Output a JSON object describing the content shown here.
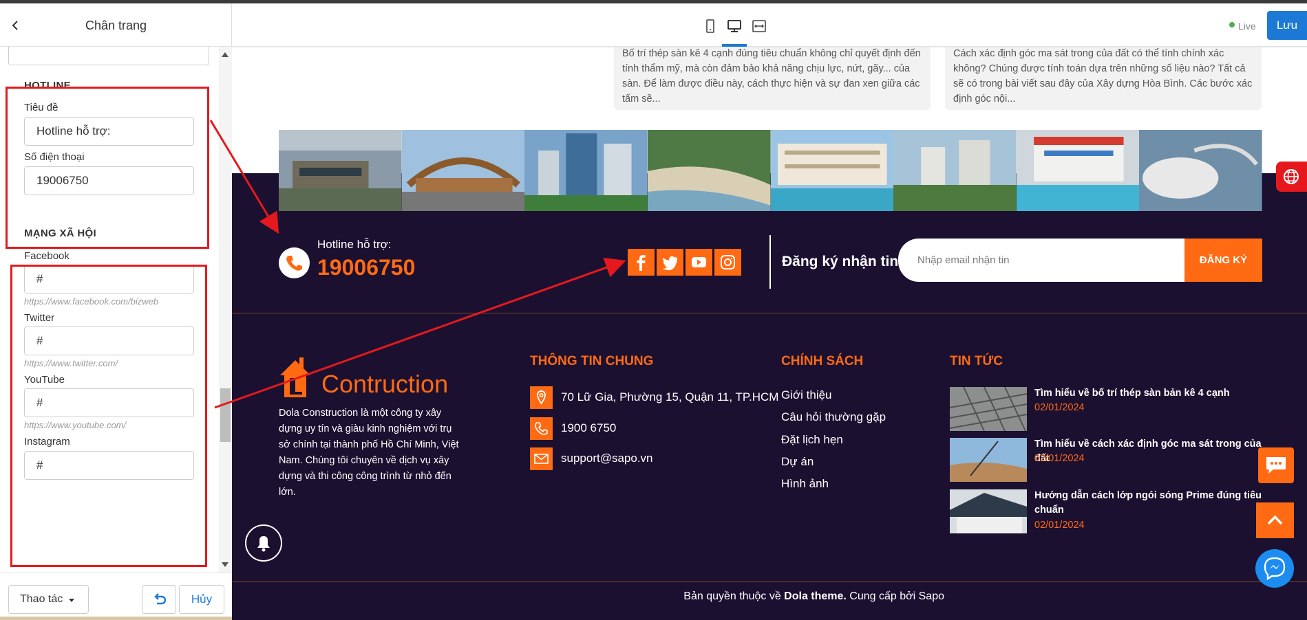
{
  "panel": {
    "title": "Chân trang",
    "hotline_section": {
      "title": "HOTLINE",
      "title_label": "Tiêu đề",
      "title_value": "Hotline hỗ trợ:",
      "phone_label": "Số điện thoại",
      "phone_value": "19006750"
    },
    "social_section": {
      "title": "MẠNG XÃ HỘI",
      "facebook_label": "Facebook",
      "facebook_value": "#",
      "facebook_hint": "https://www.facebook.com/bizweb",
      "twitter_label": "Twitter",
      "twitter_value": "#",
      "twitter_hint": "https://www.twitter.com/",
      "youtube_label": "YouTube",
      "youtube_value": "#",
      "youtube_hint": "https://www.youtube.com/",
      "instagram_label": "Instagram",
      "instagram_value": "#"
    },
    "footer": {
      "actions_label": "Thao tác",
      "cancel_label": "Hủy"
    }
  },
  "topbar": {
    "live_label": "Live",
    "save_label": "Lưu",
    "devices": [
      "mobile-icon",
      "desktop-icon",
      "fullwidth-icon"
    ],
    "active_device": "desktop"
  },
  "preview": {
    "news_cards": [
      "Bố trí thép sàn kê 4 cạnh đúng tiêu chuẩn không chỉ quyết định đến tính thẩm mỹ, mà còn đảm bảo khả năng chịu lực, nứt, gãy... của sàn. Để làm được điều này, cách thực hiện và sự đan xen giữa các tấm sẽ...",
      "Cách xác định góc ma sát trong của đất có thể tính chính xác không? Chúng được tính toán dựa trên những số liệu nào? Tất cả sẽ có trong bài viết sau đây của Xây dựng Hòa Bình. Các bước xác định góc nội..."
    ],
    "hotline_label": "Hotline hỗ trợ:",
    "hotline_number": "19006750",
    "socials": [
      "facebook-icon",
      "twitter-icon",
      "youtube-icon",
      "instagram-icon"
    ],
    "subscribe_title": "Đăng ký nhận tin",
    "email_placeholder": "Nhập email nhận tin",
    "subscribe_button": "ĐĂNG KÝ",
    "logo_text": "Contruction",
    "about": "Dola Construction là một công ty xây dựng uy tín và giàu kinh nghiệm với trụ sở chính tại thành phố Hồ Chí Minh, Việt Nam. Chúng tôi chuyên về dịch vụ xây dựng và thi công công trình từ nhỏ đến lớn.",
    "info_title": "THÔNG TIN CHUNG",
    "address": "70 Lữ Gia, Phường 15, Quận 11, TP.HCM",
    "phone": "1900 6750",
    "email": "support@sapo.vn",
    "policy_title": "CHÍNH SÁCH",
    "policy_links": [
      "Giới thiệu",
      "Câu hỏi thường gặp",
      "Đặt lịch hẹn",
      "Dự án",
      "Hình ảnh"
    ],
    "news_title": "TIN TỨC",
    "news": [
      {
        "title": "Tìm hiểu về bố trí thép sàn bản kê 4 cạnh",
        "date": "02/01/2024"
      },
      {
        "title": "Tìm hiểu về cách xác định góc ma sát trong của đất",
        "date": "02/01/2024"
      },
      {
        "title": "Hướng dẫn cách lớp ngói sóng Prime đúng tiêu chuẩn",
        "date": "02/01/2024"
      }
    ],
    "copyright_prefix": "Bản quyền thuộc về ",
    "copyright_brand": "Dola theme.",
    "copyright_suffix": " Cung cấp bởi Sapo"
  },
  "colors": {
    "accent_orange": "#ff6a13",
    "footer_bg": "#1b1030",
    "annotation_red": "#e5191d",
    "primary_blue": "#1c7ad6"
  }
}
